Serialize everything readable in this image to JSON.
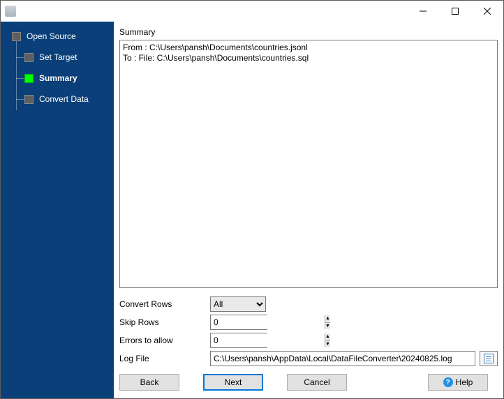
{
  "titlebar": {
    "title": ""
  },
  "sidebar": {
    "items": [
      {
        "label": "Open Source"
      },
      {
        "label": "Set Target"
      },
      {
        "label": "Summary"
      },
      {
        "label": "Convert Data"
      }
    ]
  },
  "main": {
    "section_label": "Summary",
    "summary_text": "From : C:\\Users\\pansh\\Documents\\countries.jsonl\nTo : File: C:\\Users\\pansh\\Documents\\countries.sql",
    "options": {
      "convert_rows_label": "Convert Rows",
      "convert_rows_value": "All",
      "skip_rows_label": "Skip Rows",
      "skip_rows_value": "0",
      "errors_label": "Errors to allow",
      "errors_value": "0",
      "log_file_label": "Log File",
      "log_file_value": "C:\\Users\\pansh\\AppData\\Local\\DataFileConverter\\20240825.log"
    }
  },
  "footer": {
    "back": "Back",
    "next": "Next",
    "cancel": "Cancel",
    "help": "Help"
  }
}
